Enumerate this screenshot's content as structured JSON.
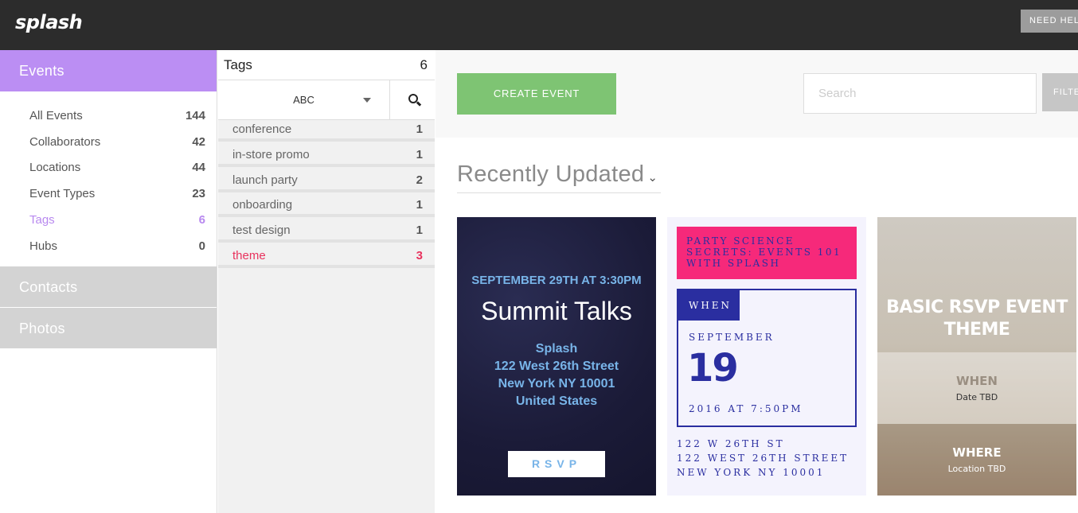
{
  "app": {
    "logo": "splash",
    "help_label": "NEED HEL"
  },
  "sidebar": {
    "events_label": "Events",
    "items": [
      {
        "label": "All Events",
        "count": "144"
      },
      {
        "label": "Collaborators",
        "count": "42"
      },
      {
        "label": "Locations",
        "count": "44"
      },
      {
        "label": "Event Types",
        "count": "23"
      },
      {
        "label": "Tags",
        "count": "6"
      },
      {
        "label": "Hubs",
        "count": "0"
      }
    ],
    "contacts_label": "Contacts",
    "photos_label": "Photos"
  },
  "tags": {
    "title": "Tags",
    "count": "6",
    "sort_value": "ABC",
    "rows": [
      {
        "label": "conference",
        "count": "1"
      },
      {
        "label": "in-store promo",
        "count": "1"
      },
      {
        "label": "launch party",
        "count": "2"
      },
      {
        "label": "onboarding",
        "count": "1"
      },
      {
        "label": "test design",
        "count": "1"
      },
      {
        "label": "theme",
        "count": "3"
      }
    ]
  },
  "main": {
    "create_label": "CREATE EVENT",
    "search_placeholder": "Search",
    "filter_label": "FILTE",
    "sort_label": "Recently Updated",
    "sort_caret": "⌄"
  },
  "cards": {
    "summit": {
      "date": "SEPTEMBER 29TH AT 3:30PM",
      "title": "Summit Talks",
      "address": [
        "Splash",
        "122 West 26th Street",
        "New York NY 10001",
        "United States"
      ],
      "rsvp": "RSVP"
    },
    "party": {
      "banner": "PARTY SCIENCE SECRETS: EVENTS 101 WITH SPLASH",
      "when": "WHEN",
      "month": "SEPTEMBER",
      "day": "19",
      "time": "2016 AT 7:50PM",
      "address": [
        "122 W 26TH ST",
        "122 WEST 26TH STREET",
        "NEW YORK NY 10001"
      ]
    },
    "basic": {
      "title": "BASIC RSVP EVENT THEME",
      "when_label": "WHEN",
      "when_value": "Date TBD",
      "where_label": "WHERE",
      "where_value": "Location TBD"
    }
  },
  "colors": {
    "events_accent": "#bb8ef3",
    "active_tag": "#e8325d",
    "create_button": "#7ec473",
    "topbar": "#2c2c2c"
  }
}
